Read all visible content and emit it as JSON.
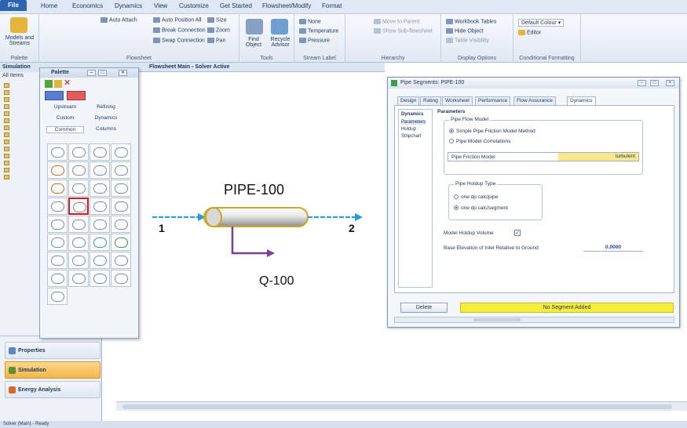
{
  "ribbon": {
    "tabs": [
      "File",
      "Home",
      "Economics",
      "Dynamics",
      "View",
      "Customize",
      "Get Started",
      "Flowsheet/Modify",
      "Format"
    ],
    "groups": [
      {
        "label": "Palette",
        "items": [
          "Models and Streams"
        ]
      },
      {
        "label": "Flowsheet",
        "items": [
          "Auto Attach",
          "Auto Position All",
          "Size",
          "Break Connection",
          "Zoom",
          "Swap Connection",
          "Pan"
        ]
      },
      {
        "label": "Tools",
        "items": [
          "Find Object",
          "Recycle Advisor"
        ]
      },
      {
        "label": "Stream Label",
        "items": [
          "None",
          "Temperature",
          "Pressure"
        ]
      },
      {
        "label": "Hierarchy",
        "items": [
          "Move to Parent",
          "Show Sub-flowsheet"
        ]
      },
      {
        "label": "Display Options",
        "items": [
          "Workbook Tables",
          "Hide Object",
          "Table Visibility"
        ]
      },
      {
        "label": "Conditional Formatting",
        "items": [
          "Default Colour",
          "Editor"
        ]
      }
    ]
  },
  "navigator": {
    "header": "Simulation",
    "all_items": "All Items",
    "nav_buttons": [
      {
        "label": "Properties"
      },
      {
        "label": "Simulation"
      },
      {
        "label": "Energy Analysis"
      }
    ]
  },
  "palette": {
    "title": "Palette",
    "categories": [
      "Upstream",
      "Refining",
      "Custom",
      "Dynamics",
      "Common",
      "Columns"
    ]
  },
  "flowsheet": {
    "title": "Flowsheet Main - Solver Active",
    "pipe_label": "PIPE-100",
    "inlet_stream": "1",
    "outlet_stream": "2",
    "energy_stream": "Q-100",
    "colors": {
      "stream": "#2a9bd6",
      "energy": "#7a3f98"
    }
  },
  "dialog": {
    "title": "Pipe Segments: PIPE-100",
    "tabs": [
      "Design",
      "Rating",
      "Worksheet",
      "Performance",
      "Flow Assurance",
      "Dynamics"
    ],
    "active_tab": "Dynamics",
    "side_nav": [
      "Dynamics",
      "Parameters",
      "Holdup",
      "Stripchart"
    ],
    "parameters_header": "Parameters",
    "pipe_flow_model": {
      "legend": "Pipe Flow Model",
      "options": [
        "Simple Pipe Friction Model Method",
        "Pipe Model Correlations"
      ],
      "selected": 0
    },
    "friction_row": {
      "label": "Pipe Friction Model",
      "value": "turbulent"
    },
    "holdup_type": {
      "legend": "Pipe Holdup Type",
      "options": [
        "one dp calc/pipe",
        "one dp calc/segment"
      ],
      "selected": 1
    },
    "model_holdup_volume_label": "Model Holdup Volume",
    "model_holdup_volume_checked": true,
    "elevation": {
      "label": "Base Elevation of Inlet Relative to Ground",
      "value": "0.0000"
    },
    "delete_button": "Delete",
    "status": "No Segment Added",
    "status_color": "#f6ee3c"
  },
  "statusbar": {
    "text": "Solver (Main) - Ready"
  }
}
